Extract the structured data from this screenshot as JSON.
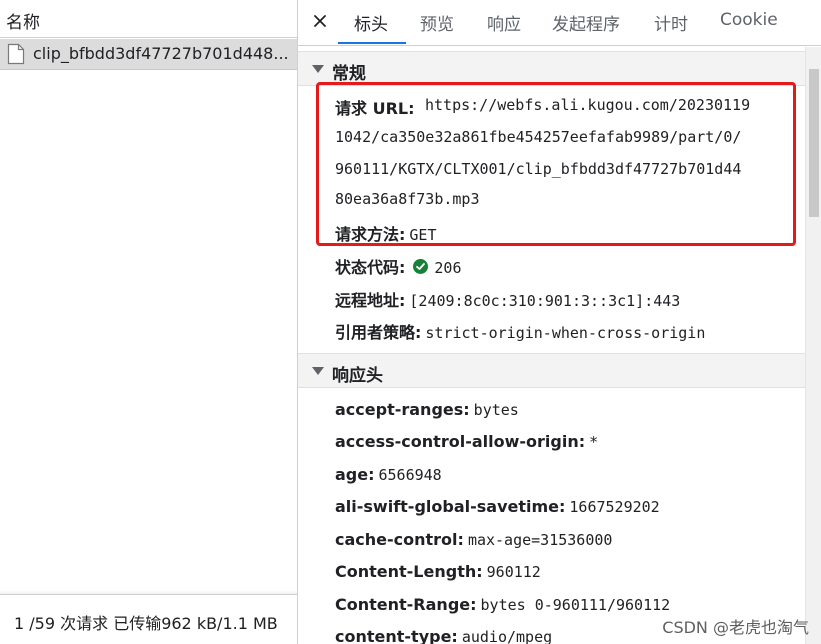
{
  "left": {
    "header_title": "名称",
    "request_name": "clip_bfbdd3df47727b701d448...",
    "status_summary": "1 /59 次请求  已传输962 kB/1.1 MB"
  },
  "tabs": [
    "标头",
    "预览",
    "响应",
    "发起程序",
    "计时",
    "Cookie"
  ],
  "active_tab": "标头",
  "general": {
    "title": "常规",
    "request_url_label": "请求 URL:",
    "request_url_lines": [
      "https://webfs.ali.kugou.com/20230119",
      "1042/ca350e32a861fbe454257eefafab9989/part/0/",
      "960111/KGTX/CLTX001/clip_bfbdd3df47727b701d44",
      "80ea36a8f73b.mp3"
    ],
    "request_method_label": "请求方法:",
    "request_method": "GET",
    "status_code_label": "状态代码:",
    "status_code": "206",
    "remote_address_label": "远程地址:",
    "remote_address": "[2409:8c0c:310:901:3::3c1]:443",
    "referrer_policy_label": "引用者策略:",
    "referrer_policy": "strict-origin-when-cross-origin"
  },
  "response_headers": {
    "title": "响应头",
    "items": [
      {
        "key": "accept-ranges:",
        "value": "bytes"
      },
      {
        "key": "access-control-allow-origin:",
        "value": "*"
      },
      {
        "key": "age:",
        "value": "6566948"
      },
      {
        "key": "ali-swift-global-savetime:",
        "value": "1667529202"
      },
      {
        "key": "cache-control:",
        "value": "max-age=31536000"
      },
      {
        "key": "Content-Length:",
        "value": "960112"
      },
      {
        "key": "Content-Range:",
        "value": "bytes 0-960111/960112"
      },
      {
        "key": "content-type:",
        "value": "audio/mpeg"
      }
    ]
  },
  "watermark": "CSDN @老虎也淘气",
  "colors": {
    "highlight": "#e31b1b",
    "status_ok": "#188038",
    "tab_underline": "#1a73e8"
  }
}
